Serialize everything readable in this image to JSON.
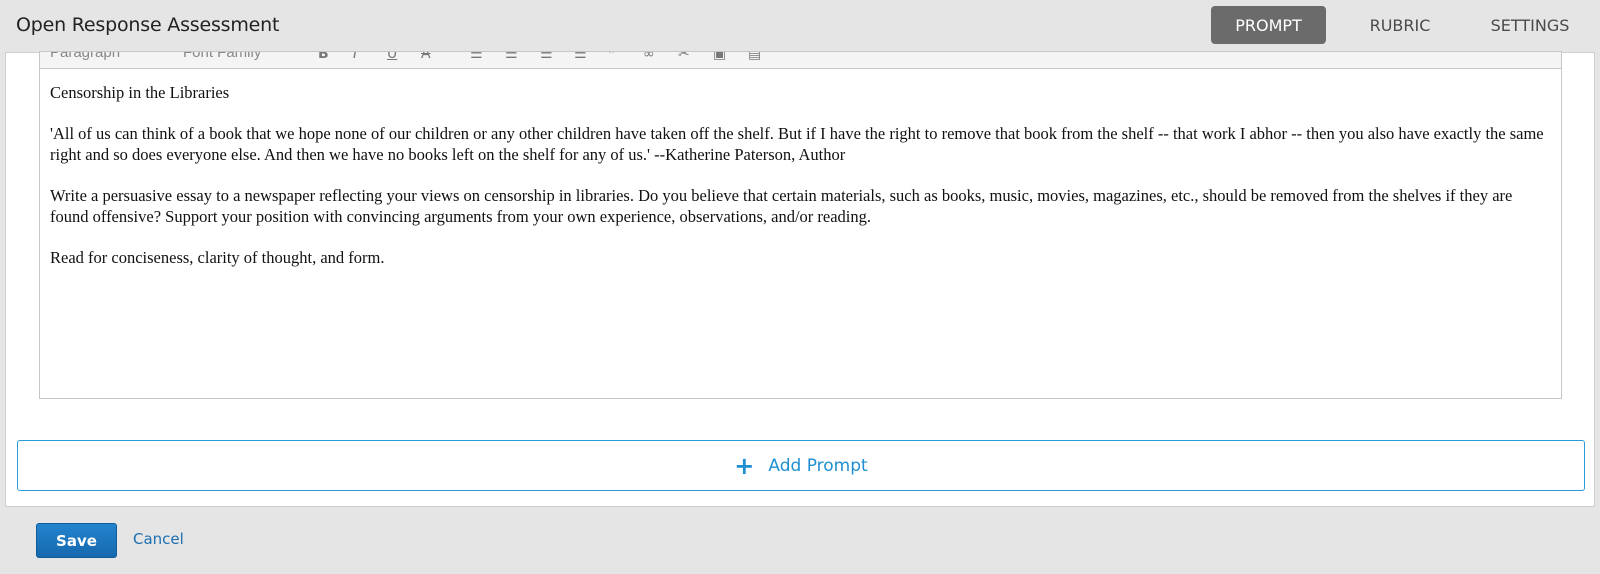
{
  "header": {
    "title": "Open Response Assessment",
    "tabs": [
      {
        "label": "PROMPT",
        "active": true
      },
      {
        "label": "RUBRIC",
        "active": false
      },
      {
        "label": "SETTINGS",
        "active": false
      }
    ]
  },
  "editor": {
    "toolbar": {
      "block_format": "Paragraph",
      "font_family": "Font Family",
      "icons": [
        "bold-icon",
        "italic-icon",
        "underline-icon",
        "strikethrough-icon",
        "bullet-list-icon",
        "numbered-list-icon",
        "outdent-icon",
        "indent-icon",
        "blockquote-icon",
        "link-icon",
        "unlink-icon",
        "image-icon",
        "code-icon"
      ]
    },
    "paragraphs": [
      "Censorship in the Libraries",
      "'All of us can think of a book that we hope none of our children or any other children have taken off the shelf. But if I have the right to remove that book from the shelf -- that work I abhor -- then you also have exactly the same right and so does everyone else. And then we have no books left on the shelf for any of us.' --Katherine Paterson, Author",
      "Write a persuasive essay to a newspaper reflecting your views on censorship in libraries. Do you believe that certain materials, such as books, music, movies, magazines, etc., should be removed from the shelves if they are found offensive? Support your position with convincing arguments from your own experience, observations, and/or reading.",
      "Read for conciseness, clarity of thought, and form."
    ]
  },
  "add_prompt": {
    "label": "Add Prompt",
    "icon": "plus-icon"
  },
  "footer": {
    "save_label": "Save",
    "cancel_label": "Cancel"
  },
  "colors": {
    "accent": "#1f8fd1",
    "save_button": "#1a74be",
    "active_tab": "#6b6b6b"
  }
}
